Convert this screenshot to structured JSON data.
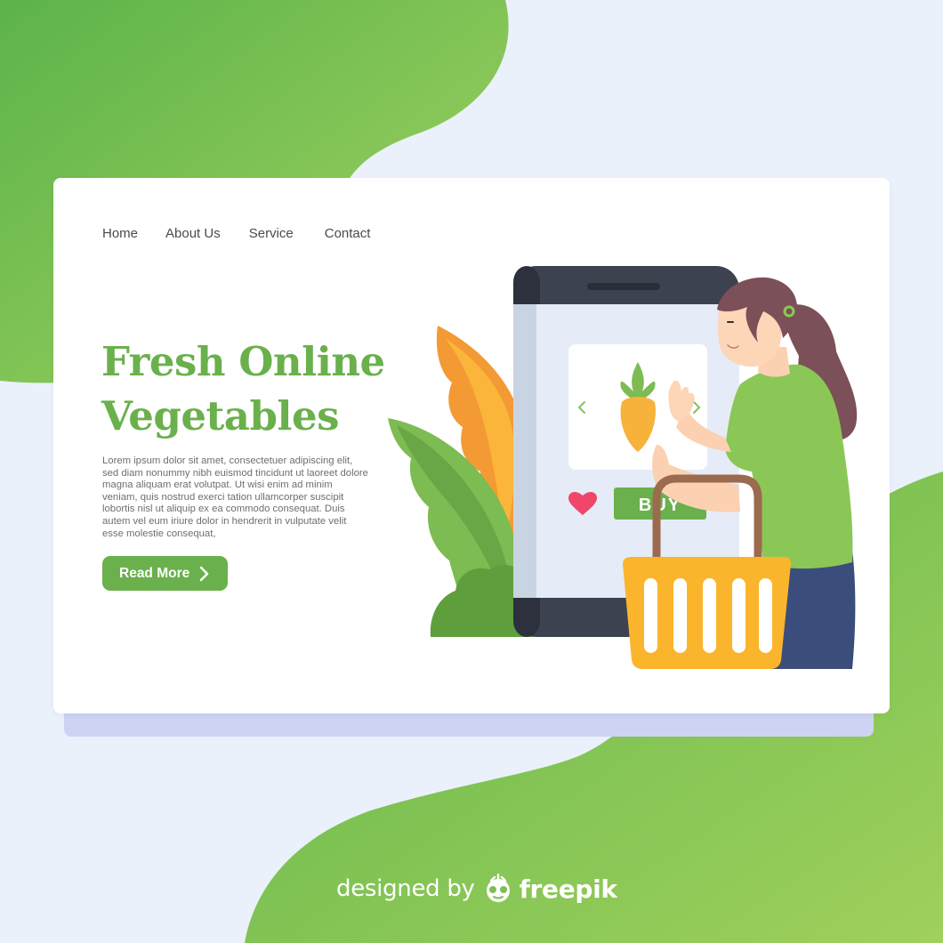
{
  "nav": {
    "items": [
      "Home",
      "About Us",
      "Service",
      "Contact"
    ]
  },
  "hero": {
    "title_line1": "Fresh Online",
    "title_line2": "Vegetables",
    "body": "Lorem ipsum dolor sit amet, consectetuer adipiscing elit, sed diam nonummy nibh euismod tincidunt ut laoreet dolore magna aliquam erat volutpat. Ut wisi enim ad minim veniam, quis nostrud exerci tation ullamcorper suscipit lobortis nisl ut aliquip ex ea commodo consequat. Duis autem vel eum iriure dolor in hendrerit in vulputate velit esse molestie consequat,",
    "cta_label": "Read More"
  },
  "phone": {
    "buy_label": "BUY"
  },
  "footer": {
    "prefix": "designed by",
    "brand": "freepik"
  },
  "colors": {
    "brand_green": "#6ab04c",
    "light_green": "#9ccf5e",
    "background": "#eaf1fb",
    "basket_yellow": "#fbb52c",
    "heart": "#f0466b"
  }
}
